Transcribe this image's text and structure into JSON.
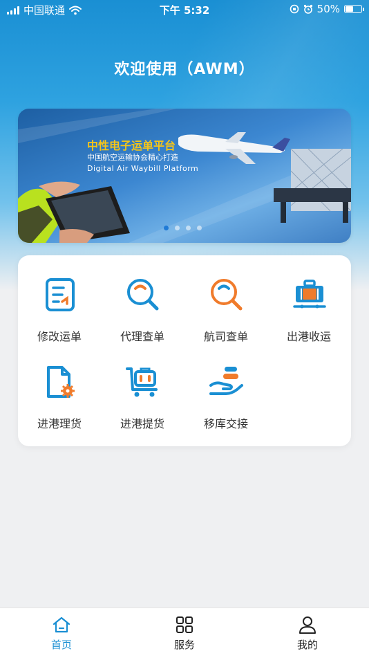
{
  "status_bar": {
    "carrier": "中国联通",
    "time": "下午 5:32",
    "battery": "50%",
    "battery_level": 0.5,
    "icons": [
      "signal-icon",
      "wifi-icon",
      "rotation-lock-icon",
      "alarm-icon",
      "battery-icon"
    ]
  },
  "header": {
    "title": "欢迎使用（AWM）"
  },
  "banner": {
    "title": "中性电子运单平台",
    "subtitle": "中国航空运输协会精心打造",
    "english": "Digital  Air  Waybill  Platform",
    "slides_total": 4,
    "active_slide": 1
  },
  "menu": {
    "items": [
      {
        "label": "修改运单",
        "icon": "waybill-edit-icon"
      },
      {
        "label": "代理查单",
        "icon": "agent-search-icon"
      },
      {
        "label": "航司查单",
        "icon": "airline-search-icon"
      },
      {
        "label": "出港收运",
        "icon": "luggage-icon"
      },
      {
        "label": "进港理货",
        "icon": "document-gear-icon"
      },
      {
        "label": "进港提货",
        "icon": "cart-pickup-icon"
      },
      {
        "label": "移库交接",
        "icon": "hand-transfer-icon"
      }
    ]
  },
  "tabbar": {
    "items": [
      {
        "label": "首页",
        "icon": "home-icon",
        "active": true
      },
      {
        "label": "服务",
        "icon": "grid-icon",
        "active": false
      },
      {
        "label": "我的",
        "icon": "user-icon",
        "active": false
      }
    ]
  },
  "colors": {
    "primary": "#1a8fd3",
    "accent_orange": "#f07b2b",
    "banner_title": "#f5c518"
  }
}
